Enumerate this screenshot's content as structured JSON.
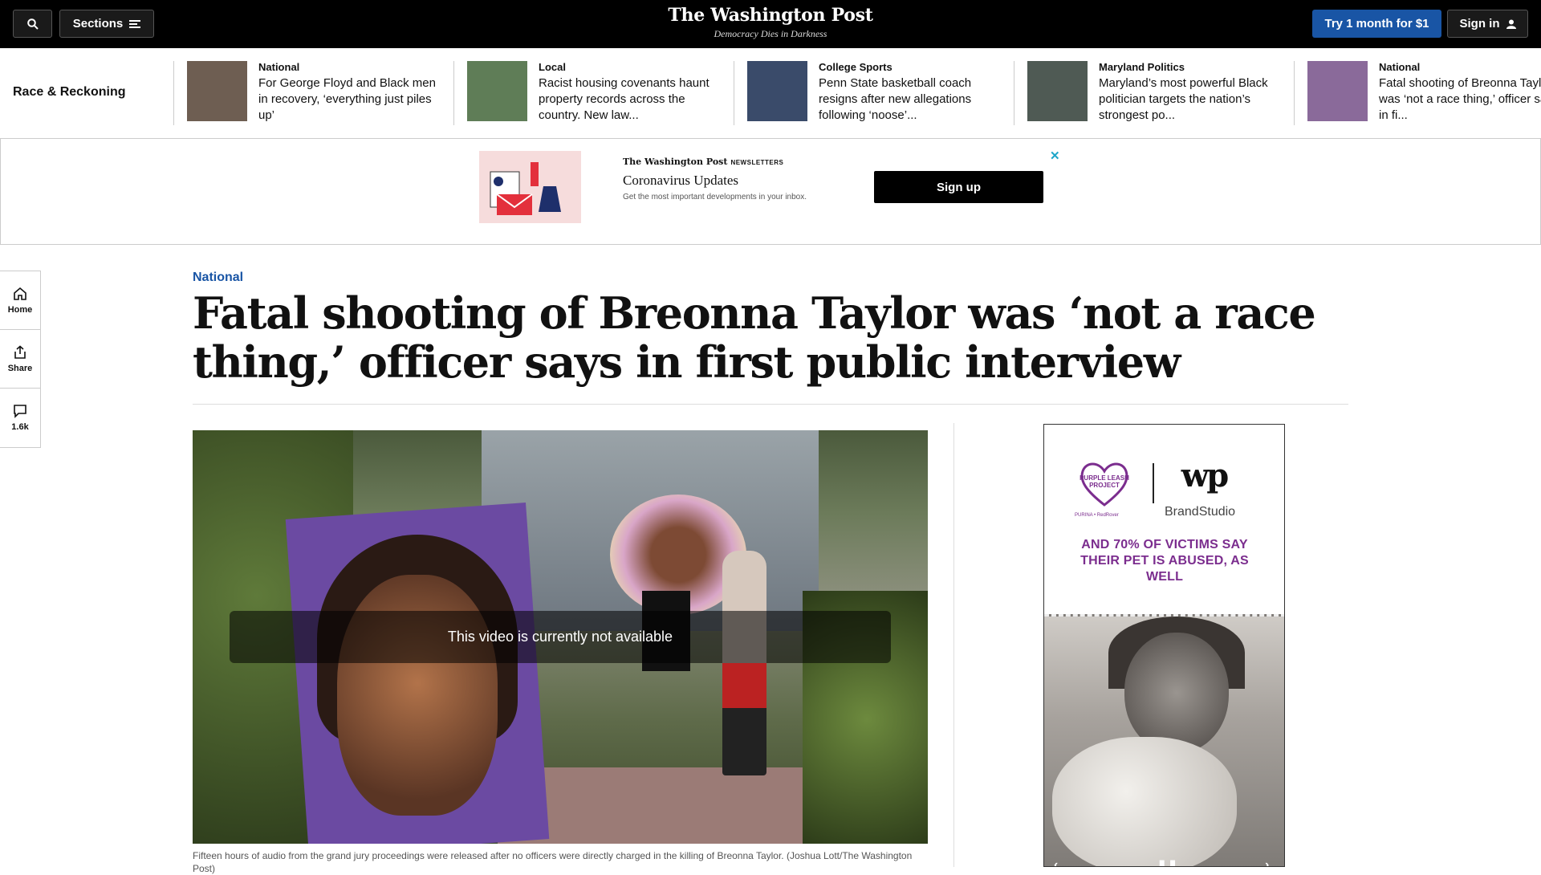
{
  "header": {
    "sections_label": "Sections",
    "logo_name": "The Washington Post",
    "logo_tagline": "Democracy Dies in Darkness",
    "try_label": "Try 1 month for $1",
    "signin_label": "Sign in"
  },
  "strip": {
    "title": "Race & Reckoning",
    "items": [
      {
        "kicker": "National",
        "headline": "For George Floyd and Black men in recovery, ‘everything just piles up’",
        "thumb_color": "#6e5e52"
      },
      {
        "kicker": "Local",
        "headline": "Racist housing covenants haunt property records across the country. New law...",
        "thumb_color": "#5f7d57"
      },
      {
        "kicker": "College Sports",
        "headline": "Penn State basketball coach resigns after new allegations following ‘noose’...",
        "thumb_color": "#3a4b6a"
      },
      {
        "kicker": "Maryland Politics",
        "headline": "Maryland’s most powerful Black politician targets the nation’s strongest po...",
        "thumb_color": "#4f5a54"
      },
      {
        "kicker": "National",
        "headline": "Fatal shooting of Breonna Taylor was ‘not a race thing,’ officer says in fi...",
        "thumb_color": "#8a6a9a"
      }
    ]
  },
  "ad_banner": {
    "brand": "The Washington Post",
    "brand_suffix": "NEWSLETTERS",
    "title": "Coronavirus Updates",
    "subtitle": "Get the most important developments in your inbox.",
    "cta": "Sign up",
    "close": "✕"
  },
  "rail": {
    "home": "Home",
    "share": "Share",
    "comments": "1.6k"
  },
  "article": {
    "kicker": "National",
    "headline": "Fatal shooting of Breonna Taylor was ‘not a race thing,’ officer says in first public interview",
    "video_message": "This video is currently not available",
    "caption": "Fifteen hours of audio from the grand jury proceedings were released after no officers were directly charged in the killing of Breonna Taylor. (Joshua Lott/The Washington Post)"
  },
  "side_ad": {
    "heart_text": "PURPLE LEASH PROJECT",
    "small_text": "PURINA • RedRover",
    "wp": "wp",
    "brandstudio": "BrandStudio",
    "message": "AND 70% OF VICTIMS SAY THEIR PET IS ABUSED, AS WELL",
    "prev": "‹",
    "pause": "❚❚",
    "next": "›"
  },
  "colors": {
    "accent_blue": "#1955a5",
    "purple": "#7b2d8e"
  }
}
